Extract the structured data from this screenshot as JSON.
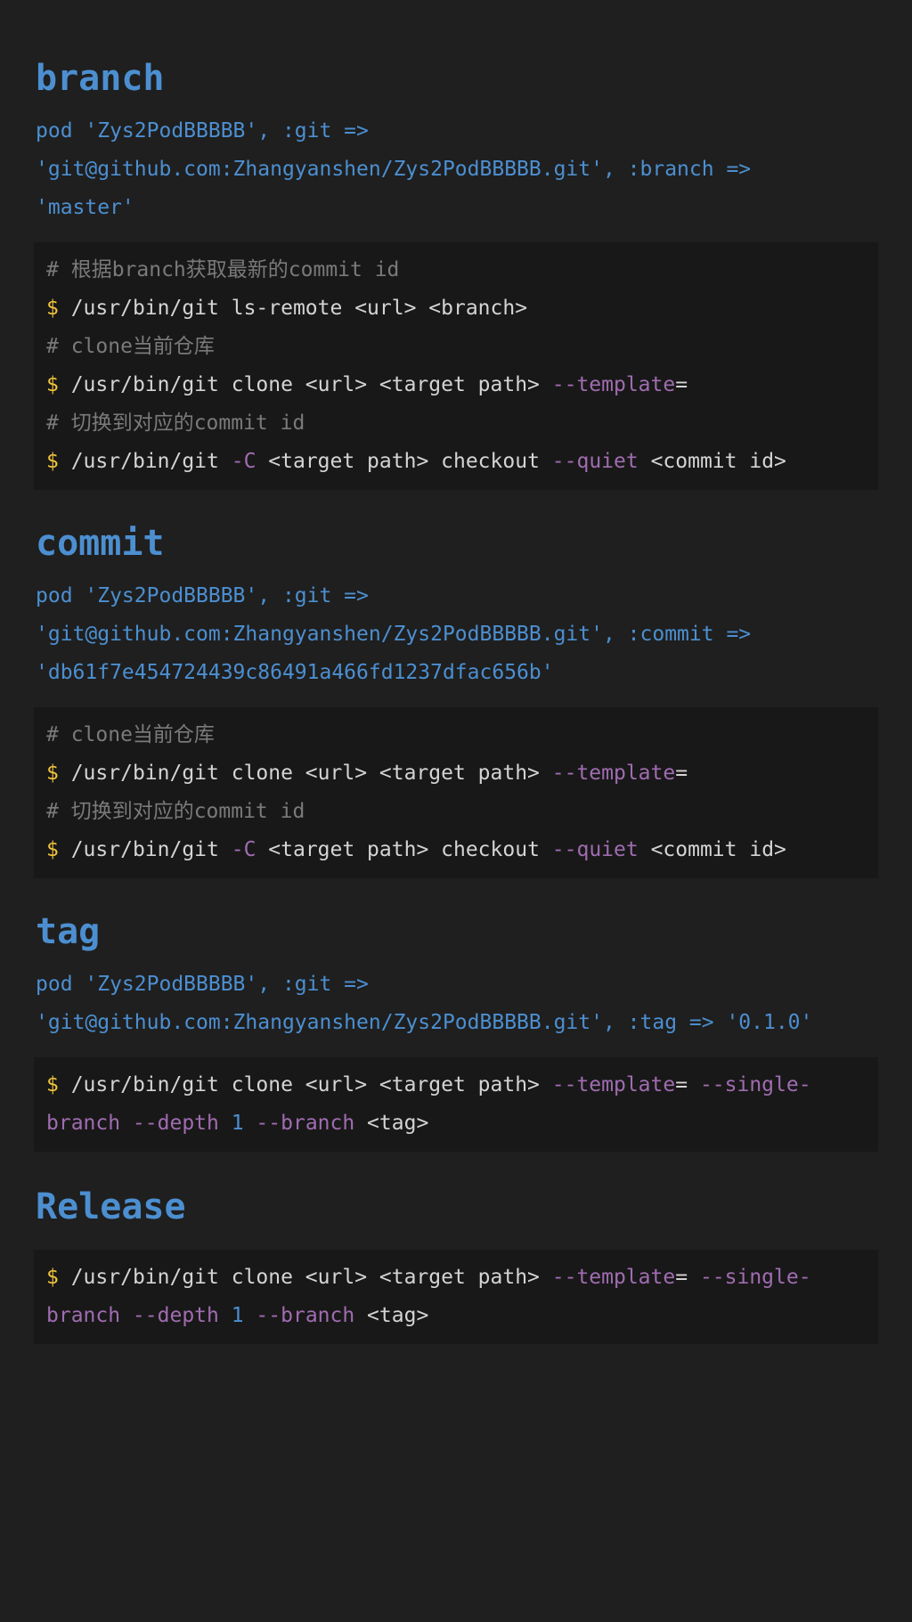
{
  "sections": [
    {
      "title": "branch",
      "pod_lines": [
        "pod 'Zys2PodBBBBB', :git =>",
        "'git@github.com:Zhangyanshen/Zys2PodBBBBB.git', :branch =>",
        "'master'"
      ],
      "code": [
        [
          {
            "t": "comment",
            "v": "# 根据branch获取最新的commit id"
          }
        ],
        [
          {
            "t": "prompt",
            "v": "$"
          },
          {
            "t": "plain",
            "v": " /usr/bin/git ls-remote <url> <branch>"
          }
        ],
        [
          {
            "t": "comment",
            "v": "# clone当前仓库"
          }
        ],
        [
          {
            "t": "prompt",
            "v": "$"
          },
          {
            "t": "plain",
            "v": " /usr/bin/git clone <url> <target path> "
          },
          {
            "t": "flag",
            "v": "--template"
          },
          {
            "t": "plain",
            "v": "="
          }
        ],
        [
          {
            "t": "comment",
            "v": "# 切换到对应的commit id"
          }
        ],
        [
          {
            "t": "prompt",
            "v": "$"
          },
          {
            "t": "plain",
            "v": " /usr/bin/git "
          },
          {
            "t": "flag",
            "v": "-C"
          },
          {
            "t": "plain",
            "v": " <target path> checkout "
          },
          {
            "t": "flag",
            "v": "--quiet"
          },
          {
            "t": "plain",
            "v": " <commit id>"
          }
        ]
      ]
    },
    {
      "title": "commit",
      "pod_lines": [
        "pod 'Zys2PodBBBBB', :git =>",
        "'git@github.com:Zhangyanshen/Zys2PodBBBBB.git', :commit =>",
        "'db61f7e454724439c86491a466fd1237dfac656b'"
      ],
      "code": [
        [
          {
            "t": "comment",
            "v": "# clone当前仓库"
          }
        ],
        [
          {
            "t": "prompt",
            "v": "$"
          },
          {
            "t": "plain",
            "v": " /usr/bin/git clone <url> <target path> "
          },
          {
            "t": "flag",
            "v": "--template"
          },
          {
            "t": "plain",
            "v": "="
          }
        ],
        [
          {
            "t": "comment",
            "v": "# 切换到对应的commit id"
          }
        ],
        [
          {
            "t": "prompt",
            "v": "$"
          },
          {
            "t": "plain",
            "v": " /usr/bin/git "
          },
          {
            "t": "flag",
            "v": "-C"
          },
          {
            "t": "plain",
            "v": " <target path> checkout "
          },
          {
            "t": "flag",
            "v": "--quiet"
          },
          {
            "t": "plain",
            "v": " <commit id>"
          }
        ]
      ]
    },
    {
      "title": "tag",
      "pod_lines": [
        "pod 'Zys2PodBBBBB', :git =>",
        "'git@github.com:Zhangyanshen/Zys2PodBBBBB.git', :tag => '0.1.0'"
      ],
      "code": [
        [
          {
            "t": "prompt",
            "v": "$"
          },
          {
            "t": "plain",
            "v": " /usr/bin/git clone <url> <target path> "
          },
          {
            "t": "flag",
            "v": "--template"
          },
          {
            "t": "plain",
            "v": "= "
          },
          {
            "t": "flag",
            "v": "--single-"
          }
        ],
        [
          {
            "t": "flag",
            "v": "branch --depth "
          },
          {
            "t": "num",
            "v": "1"
          },
          {
            "t": "flag",
            "v": " --branch"
          },
          {
            "t": "plain",
            "v": " <tag>"
          }
        ]
      ]
    },
    {
      "title": "Release",
      "pod_lines": [],
      "code": [
        [
          {
            "t": "prompt",
            "v": "$"
          },
          {
            "t": "plain",
            "v": " /usr/bin/git clone <url> <target path> "
          },
          {
            "t": "flag",
            "v": "--template"
          },
          {
            "t": "plain",
            "v": "= "
          },
          {
            "t": "flag",
            "v": "--single-"
          }
        ],
        [
          {
            "t": "flag",
            "v": "branch --depth "
          },
          {
            "t": "num",
            "v": "1"
          },
          {
            "t": "flag",
            "v": " --branch"
          },
          {
            "t": "plain",
            "v": " <tag>"
          }
        ]
      ]
    }
  ],
  "colors": {
    "background": "#1f1f1f",
    "code_background": "#181818",
    "heading": "#4c8fd1",
    "comment": "#7a7a7a",
    "prompt": "#f0c43c",
    "flag": "#a06cb0"
  }
}
